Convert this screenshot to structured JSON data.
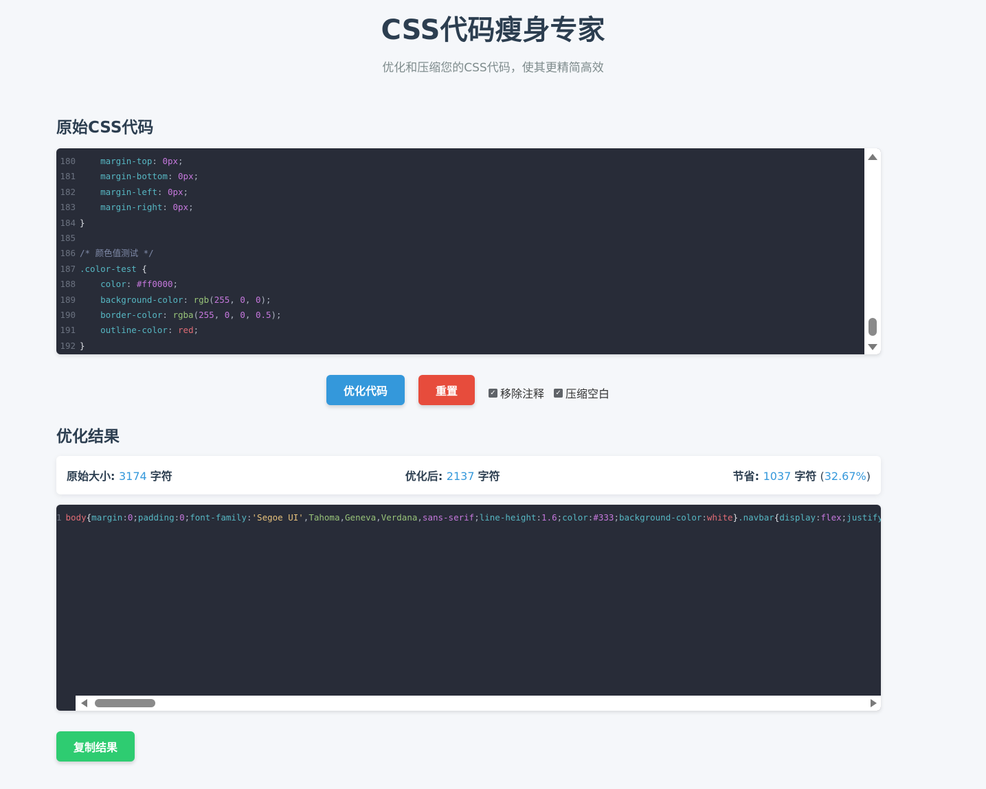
{
  "header": {
    "title": "CSS代码瘦身专家",
    "subtitle": "优化和压缩您的CSS代码，使其更精简高效"
  },
  "input_section": {
    "title": "原始CSS代码",
    "lines": [
      {
        "n": "180",
        "tokens": [
          [
            "",
            "    "
          ],
          [
            "prop",
            "margin-top"
          ],
          [
            "",
            ": "
          ],
          [
            "val",
            "0px"
          ],
          [
            "",
            ";"
          ]
        ]
      },
      {
        "n": "181",
        "tokens": [
          [
            "",
            "    "
          ],
          [
            "prop",
            "margin-bottom"
          ],
          [
            "",
            ": "
          ],
          [
            "val",
            "0px"
          ],
          [
            "",
            ";"
          ]
        ]
      },
      {
        "n": "182",
        "tokens": [
          [
            "",
            "    "
          ],
          [
            "prop",
            "margin-left"
          ],
          [
            "",
            ": "
          ],
          [
            "val",
            "0px"
          ],
          [
            "",
            ";"
          ]
        ]
      },
      {
        "n": "183",
        "tokens": [
          [
            "",
            "    "
          ],
          [
            "prop",
            "margin-right"
          ],
          [
            "",
            ": "
          ],
          [
            "val",
            "0px"
          ],
          [
            "",
            ";"
          ]
        ]
      },
      {
        "n": "184",
        "tokens": [
          [
            "br",
            "}"
          ]
        ]
      },
      {
        "n": "185",
        "tokens": []
      },
      {
        "n": "186",
        "tokens": [
          [
            "cmt",
            "/* 颜色值测试 */"
          ]
        ]
      },
      {
        "n": "187",
        "tokens": [
          [
            "sel",
            ".color-test"
          ],
          [
            "br",
            " {"
          ]
        ]
      },
      {
        "n": "188",
        "tokens": [
          [
            "",
            "    "
          ],
          [
            "prop",
            "color"
          ],
          [
            "",
            ": "
          ],
          [
            "val",
            "#ff0000"
          ],
          [
            "",
            ";"
          ]
        ]
      },
      {
        "n": "189",
        "tokens": [
          [
            "",
            "    "
          ],
          [
            "prop",
            "background-color"
          ],
          [
            "",
            ": "
          ],
          [
            "fn",
            "rgb"
          ],
          [
            "",
            "("
          ],
          [
            "val",
            "255"
          ],
          [
            "",
            ", "
          ],
          [
            "val",
            "0"
          ],
          [
            "",
            ", "
          ],
          [
            "val",
            "0"
          ],
          [
            "",
            ");"
          ]
        ]
      },
      {
        "n": "190",
        "tokens": [
          [
            "",
            "    "
          ],
          [
            "prop",
            "border-color"
          ],
          [
            "",
            ": "
          ],
          [
            "fn",
            "rgba"
          ],
          [
            "",
            "("
          ],
          [
            "val",
            "255"
          ],
          [
            "",
            ", "
          ],
          [
            "val",
            "0"
          ],
          [
            "",
            ", "
          ],
          [
            "val",
            "0"
          ],
          [
            "",
            ", "
          ],
          [
            "val",
            "0.5"
          ],
          [
            "",
            ");"
          ]
        ]
      },
      {
        "n": "191",
        "tokens": [
          [
            "",
            "    "
          ],
          [
            "prop",
            "outline-color"
          ],
          [
            "",
            ": "
          ],
          [
            "kw",
            "red"
          ],
          [
            "",
            ";"
          ]
        ]
      },
      {
        "n": "192",
        "tokens": [
          [
            "br",
            "}"
          ]
        ]
      }
    ]
  },
  "controls": {
    "optimize_label": "优化代码",
    "reset_label": "重置",
    "remove_comments_label": "移除注释",
    "compress_whitespace_label": "压缩空白",
    "remove_comments_checked": true,
    "compress_whitespace_checked": true
  },
  "result_section": {
    "title": "优化结果",
    "original_label": "原始大小",
    "original_value": "3174",
    "optimized_label": "优化后",
    "optimized_value": "2137",
    "saved_label": "节省",
    "saved_value": "1037",
    "saved_percent": "32.67%",
    "unit": "字符",
    "output_lines": [
      {
        "n": "1",
        "tokens": [
          [
            "kw",
            "body"
          ],
          [
            "br",
            "{"
          ],
          [
            "prop",
            "margin"
          ],
          [
            "",
            ":"
          ],
          [
            "val",
            "0"
          ],
          [
            "",
            ";"
          ],
          [
            "prop",
            "padding"
          ],
          [
            "",
            ":"
          ],
          [
            "val",
            "0"
          ],
          [
            "",
            ";"
          ],
          [
            "prop",
            "font-family"
          ],
          [
            "",
            ":"
          ],
          [
            "str",
            "'Segoe UI'"
          ],
          [
            "",
            ","
          ],
          [
            "fn",
            "Tahoma"
          ],
          [
            "",
            ","
          ],
          [
            "fn",
            "Geneva"
          ],
          [
            "",
            ","
          ],
          [
            "fn",
            "Verdana"
          ],
          [
            "",
            ","
          ],
          [
            "val",
            "sans-serif"
          ],
          [
            "",
            ";"
          ],
          [
            "prop",
            "line-height"
          ],
          [
            "",
            ":"
          ],
          [
            "val",
            "1.6"
          ],
          [
            "",
            ";"
          ],
          [
            "prop",
            "color"
          ],
          [
            "",
            ":"
          ],
          [
            "val",
            "#333"
          ],
          [
            "",
            ";"
          ],
          [
            "prop",
            "background-color"
          ],
          [
            "",
            ":"
          ],
          [
            "kw",
            "white"
          ],
          [
            "br",
            "}"
          ],
          [
            "sel",
            ".navbar"
          ],
          [
            "br",
            "{"
          ],
          [
            "prop",
            "display"
          ],
          [
            "",
            ":"
          ],
          [
            "val",
            "flex"
          ],
          [
            "",
            ";"
          ],
          [
            "prop",
            "justify-content"
          ],
          [
            "",
            ":"
          ]
        ]
      }
    ]
  },
  "copy_label": "复制结果"
}
